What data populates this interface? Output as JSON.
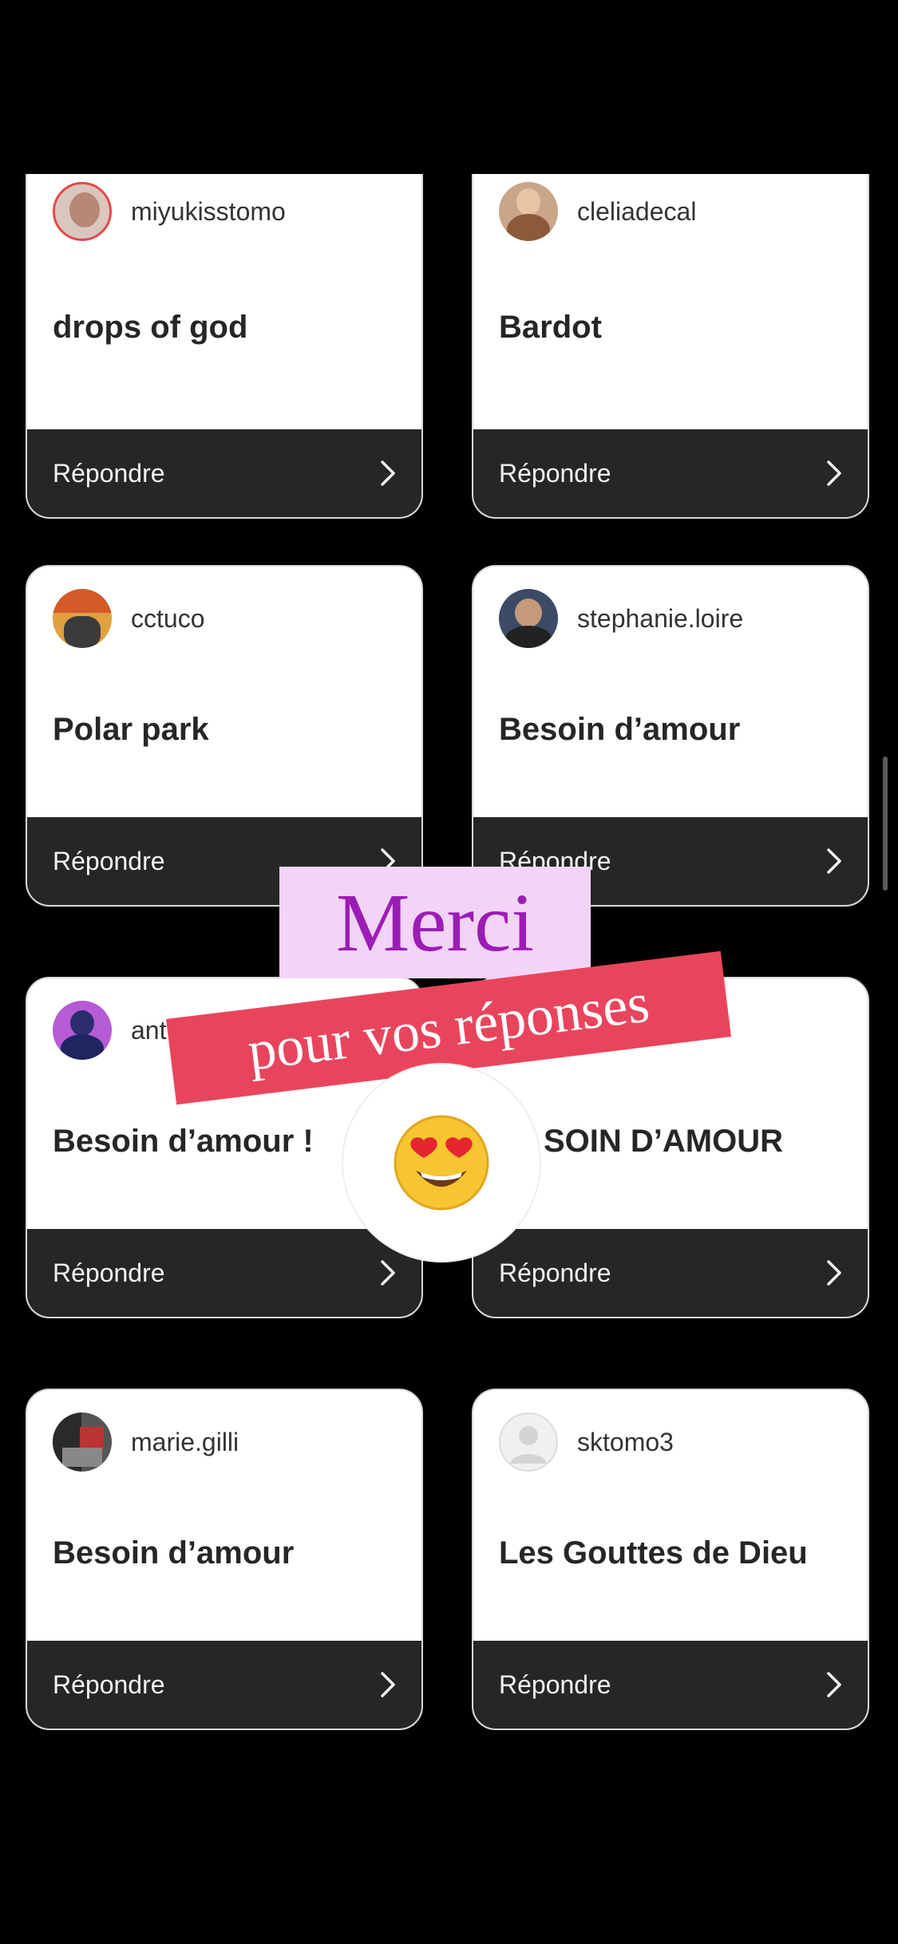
{
  "reply_label": "Répondre",
  "cards": [
    {
      "username": "miyukisstomo",
      "answer": "drops of god"
    },
    {
      "username": "cleliadecal",
      "answer": "Bardot"
    },
    {
      "username": "cctuco",
      "answer": "Polar park"
    },
    {
      "username": "stephanie.loire",
      "answer": "Besoin d’amour"
    },
    {
      "username": "ant",
      "answer": "Besoin d’amour !"
    },
    {
      "username": "",
      "answer": "SOIN D’AMOUR"
    },
    {
      "username": "marie.gilli",
      "answer": "Besoin d’amour"
    },
    {
      "username": "sktomo3",
      "answer": "Les Gouttes de Dieu"
    }
  ],
  "stickers": {
    "merci": "Merci",
    "pour_vos_reponses": "pour vos réponses",
    "emoji": "😍"
  },
  "colors": {
    "background": "#000000",
    "card_bg": "#ffffff",
    "reply_bar": "#262626",
    "merci_bg": "#f2d4f7",
    "merci_text": "#9c1cb6",
    "pour_bg": "#e8455d"
  }
}
